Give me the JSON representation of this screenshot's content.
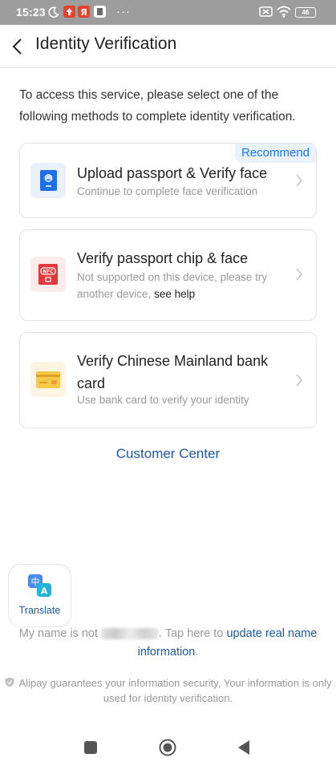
{
  "status_bar": {
    "time": "15:23",
    "battery": "46",
    "icons": [
      "moon-icon",
      "upload-app-icon",
      "yandex-app-icon",
      "app-icon",
      "more-dots-icon",
      "sim-icon",
      "wifi-icon",
      "battery-icon"
    ]
  },
  "header": {
    "title": "Identity Verification"
  },
  "intro": "To access this service, please select one of the following methods to complete identity verification.",
  "methods": [
    {
      "badge": "Recommend",
      "title": "Upload passport & Verify face",
      "subtitle": "Continue to complete face verification",
      "icon": "passport-icon"
    },
    {
      "title": "Verify passport chip & face",
      "subtitle": "Not supported on this device, please try another device,",
      "link": "see help",
      "icon": "nfc-passport-icon",
      "icon_text": "NFC"
    },
    {
      "title": "Verify Chinese Mainland bank card",
      "subtitle": "Use bank card to verify your identity",
      "icon": "bank-card-icon"
    }
  ],
  "customer_center": "Customer Center",
  "translate": {
    "label": "Translate",
    "icon_text_a": "中",
    "icon_text_b": "A"
  },
  "name_notice": {
    "prefix": "My name is not",
    "middle": ". Tap here to",
    "link": "update real name information",
    "suffix": "."
  },
  "security_notice": "Alipay guarantees your information security, Your information is only used for identity verification.",
  "colors": {
    "accent": "#1677ff",
    "link": "#1c5aa5",
    "badge_bg": "#e9f2fd"
  }
}
